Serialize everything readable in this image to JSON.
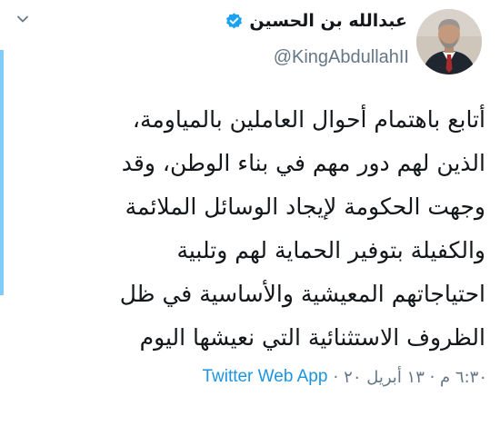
{
  "tweet": {
    "display_name": "عبدالله بن الحسين",
    "handle": "@KingAbdullahII",
    "verified": true,
    "body_lines": [
      "أتابع باهتمام أحوال العاملين بالمياومة،",
      "الذين لهم دور مهم في بناء الوطن، وقد",
      "وجهت الحكومة لإيجاد الوسائل الملائمة",
      "والكفيلة بتوفير الحماية لهم وتلبية",
      "احتياجاتهم المعيشية والأساسية في ظل",
      "الظروف الاستثنائية التي نعيشها اليوم"
    ],
    "timestamp": "٦:٣٠ م · ١٣ أبريل ٢٠",
    "separator": "·",
    "source": "Twitter Web App"
  },
  "icons": {
    "caret": "chevron-down-icon",
    "verified": "verified-badge-icon",
    "avatar": "profile-photo"
  },
  "colors": {
    "verified": "#1da1f2",
    "link": "#1b95e0",
    "secondary_text": "#657786",
    "primary_text": "#14171a"
  }
}
